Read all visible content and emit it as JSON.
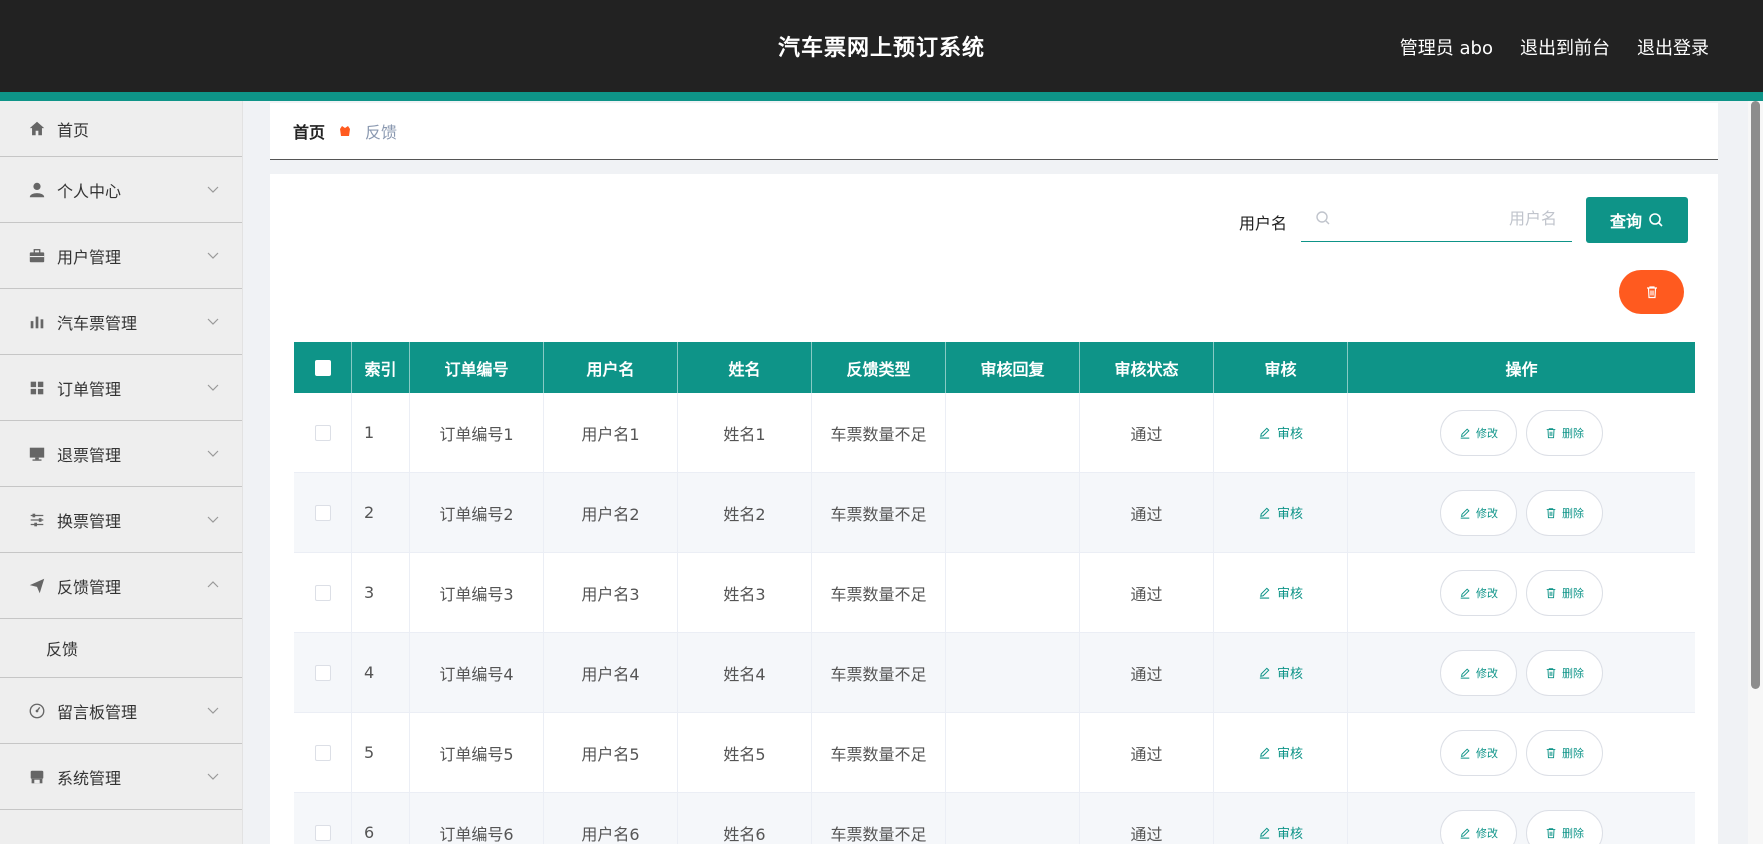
{
  "header": {
    "title": "汽车票网上预订系统",
    "links": [
      "管理员 abo",
      "退出到前台",
      "退出登录"
    ]
  },
  "sidebar": {
    "items": [
      {
        "label": "首页",
        "icon": "home-icon"
      },
      {
        "label": "个人中心",
        "icon": "user-icon"
      },
      {
        "label": "用户管理",
        "icon": "briefcase-icon"
      },
      {
        "label": "汽车票管理",
        "icon": "bar-chart-icon"
      },
      {
        "label": "订单管理",
        "icon": "grid-icon"
      },
      {
        "label": "退票管理",
        "icon": "monitor-icon"
      },
      {
        "label": "换票管理",
        "icon": "sliders-icon"
      },
      {
        "label": "反馈管理",
        "icon": "send-icon"
      },
      {
        "label": "留言板管理",
        "icon": "dashboard-icon"
      },
      {
        "label": "系统管理",
        "icon": "store-icon"
      }
    ],
    "submenu_feedback": "反馈"
  },
  "breadcrumb": {
    "home": "首页",
    "current": "反馈"
  },
  "search": {
    "label": "用户名",
    "placeholder": "用户名",
    "button": "查询"
  },
  "table": {
    "headers": [
      "索引",
      "订单编号",
      "用户名",
      "姓名",
      "反馈类型",
      "审核回复",
      "审核状态",
      "审核",
      "操作"
    ],
    "audit_label": "审核",
    "edit_label": "修改",
    "delete_label": "删除",
    "rows": [
      {
        "index": "1",
        "order_no": "订单编号1",
        "username": "用户名1",
        "name": "姓名1",
        "type": "车票数量不足",
        "reply": "",
        "status": "通过"
      },
      {
        "index": "2",
        "order_no": "订单编号2",
        "username": "用户名2",
        "name": "姓名2",
        "type": "车票数量不足",
        "reply": "",
        "status": "通过"
      },
      {
        "index": "3",
        "order_no": "订单编号3",
        "username": "用户名3",
        "name": "姓名3",
        "type": "车票数量不足",
        "reply": "",
        "status": "通过"
      },
      {
        "index": "4",
        "order_no": "订单编号4",
        "username": "用户名4",
        "name": "姓名4",
        "type": "车票数量不足",
        "reply": "",
        "status": "通过"
      },
      {
        "index": "5",
        "order_no": "订单编号5",
        "username": "用户名5",
        "name": "姓名5",
        "type": "车票数量不足",
        "reply": "",
        "status": "通过"
      },
      {
        "index": "6",
        "order_no": "订单编号6",
        "username": "用户名6",
        "name": "姓名6",
        "type": "车票数量不足",
        "reply": "",
        "status": "通过"
      }
    ]
  },
  "colors": {
    "accent": "#0e9488",
    "danger": "#ff5a1f",
    "header_bg": "#222222"
  }
}
